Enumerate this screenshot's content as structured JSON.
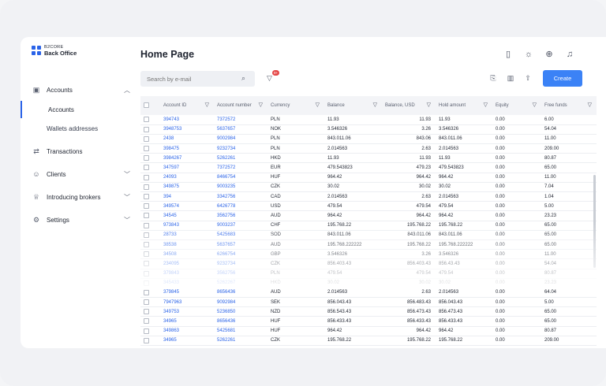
{
  "brand": {
    "line1": "B2CORE",
    "line2": "Back Office"
  },
  "nav": {
    "accounts": "Accounts",
    "sub_accounts": "Accounts",
    "sub_wallets": "Wallets addresses",
    "transactions": "Transactions",
    "clients": "Clients",
    "introducing_brokers": "Introducing brokers",
    "settings": "Settings"
  },
  "page_title": "Home Page",
  "search": {
    "placeholder": "Search by e-mail"
  },
  "filter_badge": "9+",
  "create_label": "Create",
  "columns": [
    "Account ID",
    "Account number",
    "Currency",
    "Balance",
    "Balance, USD",
    "Hold amount",
    "Equity",
    "Free funds"
  ],
  "rows": [
    [
      "394743",
      "7372572",
      "PLN",
      "11.93",
      "11.93",
      "11.93",
      "0.00",
      "6.00"
    ],
    [
      "3948753",
      "5637657",
      "NOK",
      "3.546326",
      "3.26",
      "3.546326",
      "0.00",
      "54.04"
    ],
    [
      "2438",
      "9002984",
      "PLN",
      "843.011.06",
      "843.06",
      "843.011.06",
      "0.00",
      "11.00"
    ],
    [
      "398475",
      "9232734",
      "PLN",
      "2.014563",
      "2.63",
      "2.014563",
      "0.00",
      "209.00"
    ],
    [
      "3984267",
      "5262261",
      "HKD",
      "11.93",
      "11.93",
      "11.93",
      "0.00",
      "80.87"
    ],
    [
      "347597",
      "7372572",
      "EUR",
      "479.543823",
      "479.23",
      "479.543823",
      "0.00",
      "65.00"
    ],
    [
      "24093",
      "8466754",
      "HUF",
      "964.42",
      "964.42",
      "964.42",
      "0.00",
      "11.00"
    ],
    [
      "349875",
      "9003235",
      "CZK",
      "30.02",
      "30.02",
      "30.02",
      "0.00",
      "7.04"
    ],
    [
      "394",
      "3342756",
      "CAD",
      "2.014563",
      "2.63",
      "2.014563",
      "0.00",
      "1.04"
    ],
    [
      "349574",
      "6426778",
      "USD",
      "479.54",
      "479.54",
      "479.54",
      "0.00",
      "5.00"
    ],
    [
      "34545",
      "3562756",
      "AUD",
      "964.42",
      "964.42",
      "964.42",
      "0.00",
      "23.23"
    ],
    [
      "973843",
      "9003237",
      "CHF",
      "195.768.22",
      "195.768.22",
      "195.768.22",
      "0.00",
      "65.00"
    ],
    [
      "28733",
      "5425683",
      "SOD",
      "843.011.06",
      "843.011.06",
      "843.011.06",
      "0.00",
      "65.00"
    ],
    [
      "38538",
      "5637657",
      "AUD",
      "195.768.222222",
      "195.768.22",
      "195.768.222222",
      "0.00",
      "65.00"
    ],
    [
      "34508",
      "6266754",
      "GBP",
      "3.546326",
      "3.26",
      "3.546326",
      "0.00",
      "11.00"
    ],
    [
      "234095",
      "9232734",
      "CZK",
      "856.403.43",
      "856.403.43",
      "856.43.43",
      "0.00",
      "54.04"
    ],
    [
      "379843",
      "3562756",
      "PLN",
      "479.54",
      "479.54",
      "479.54",
      "0.00",
      "80.87"
    ],
    [
      "345433",
      "5262267",
      "HKD",
      "30.02",
      "30.02",
      "30.02",
      "0.00",
      "23.23"
    ],
    [
      "379845",
      "8656436",
      "AUD",
      "2.014563",
      "2.63",
      "2.014563",
      "0.00",
      "64.04"
    ],
    [
      "7947963",
      "9092984",
      "SEK",
      "856.043.43",
      "856.483.43",
      "856.043.43",
      "0.00",
      "5.00"
    ],
    [
      "349753",
      "5236850",
      "NZD",
      "856.543.43",
      "856.473.43",
      "856.473.43",
      "0.00",
      "65.00"
    ],
    [
      "34965",
      "8656436",
      "HUF",
      "856.433.43",
      "856.433.43",
      "856.433.43",
      "0.00",
      "65.00"
    ],
    [
      "349863",
      "5425681",
      "HUF",
      "964.42",
      "964.42",
      "964.42",
      "0.00",
      "80.87"
    ],
    [
      "34965",
      "5262261",
      "CZK",
      "195.768.22",
      "195.768.22",
      "195.768.22",
      "0.00",
      "209.00"
    ]
  ]
}
